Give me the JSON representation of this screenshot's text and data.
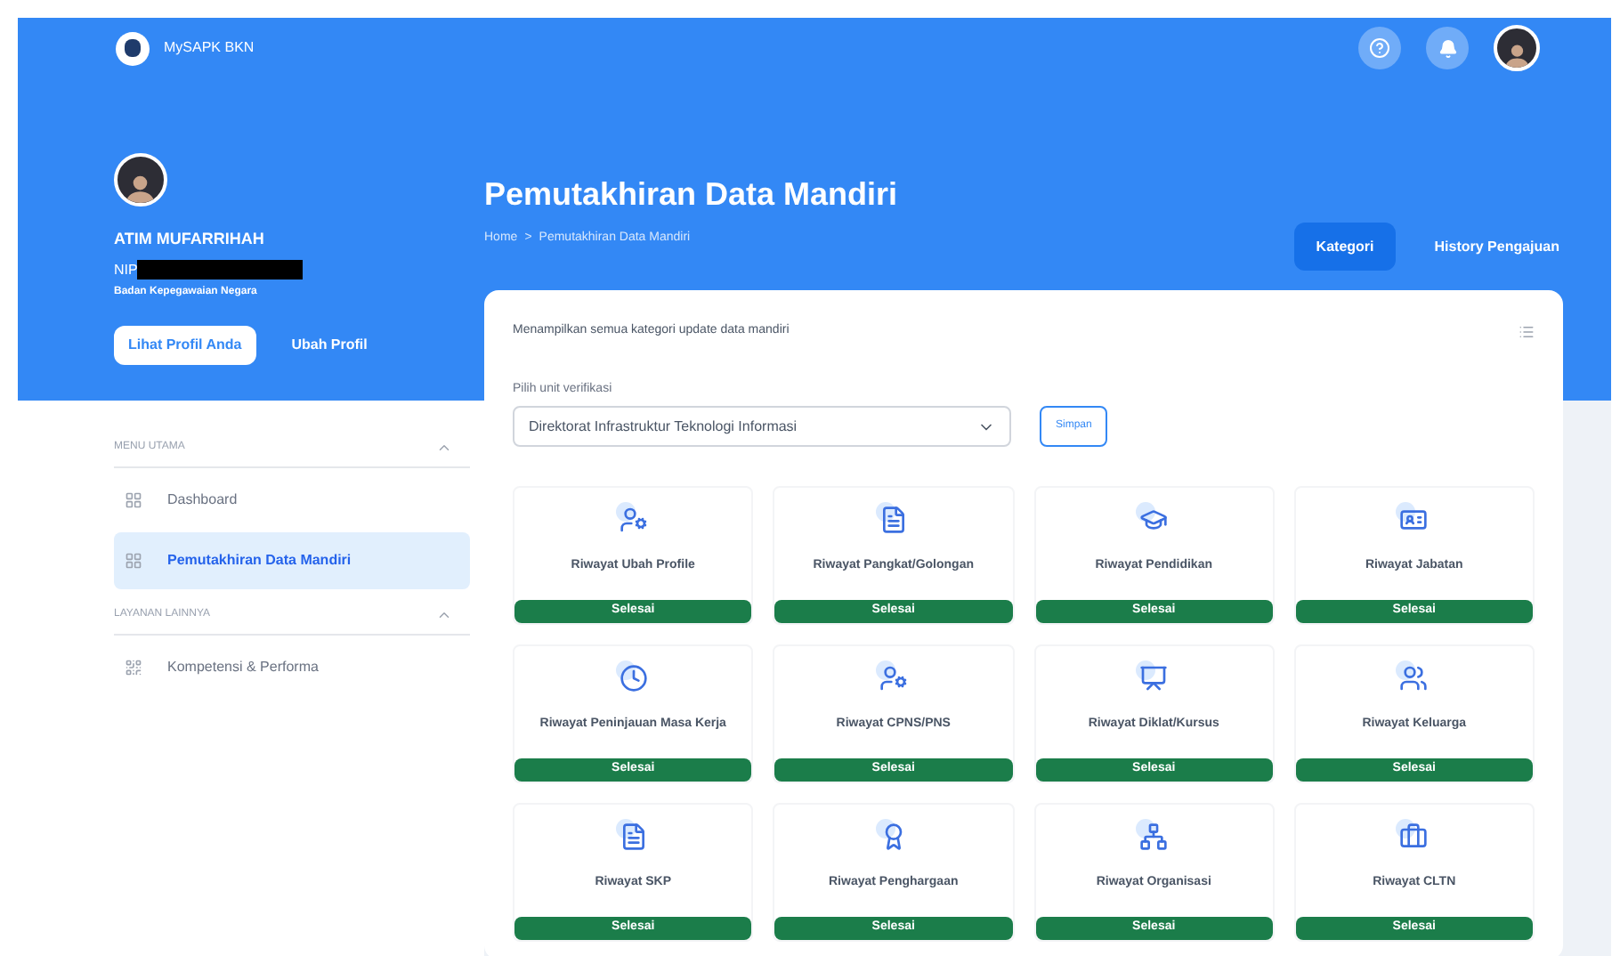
{
  "app": {
    "name": "MySAPK BKN"
  },
  "profile": {
    "name": "ATIM MUFARRIHAH",
    "nip_label": "NIP",
    "agency": "Badan Kepegawaian Negara",
    "buttons": [
      {
        "label": "Lihat Profil Anda",
        "kind": "primary"
      },
      {
        "label": "Ubah Profil",
        "kind": "link"
      }
    ]
  },
  "sidebar": {
    "sections": [
      {
        "title": "MENU UTAMA",
        "expanded": true,
        "items": [
          {
            "label": "Dashboard",
            "selected": false
          },
          {
            "label": "Pemutakhiran Data Mandiri",
            "selected": true
          }
        ]
      },
      {
        "title": "LAYANAN LAINNYA",
        "expanded": true,
        "items": [
          {
            "label": "Kompetensi & Performa",
            "selected": false
          }
        ]
      }
    ]
  },
  "page": {
    "title": "Pemutakhiran Data Mandiri",
    "breadcrumb": [
      "Home",
      ">",
      "Pemutakhiran Data Mandiri"
    ],
    "tabs": [
      {
        "label": "Kategori",
        "selected": true
      },
      {
        "label": "History Pengajuan",
        "selected": false
      }
    ]
  },
  "card": {
    "description": "Menampilkan semua kategori update data mandiri",
    "unit_label": "Pilih unit verifikasi",
    "unit_value": "Direktorat Infrastruktur Teknologi Informasi",
    "save_button": "Simpan",
    "categories": [
      {
        "label": "Riwayat Ubah Profile",
        "status": "Selesai"
      },
      {
        "label": "Riwayat Pangkat/Golongan",
        "status": "Selesai"
      },
      {
        "label": "Riwayat Pendidikan",
        "status": "Selesai"
      },
      {
        "label": "Riwayat Jabatan",
        "status": "Selesai"
      },
      {
        "label": "Riwayat Peninjauan Masa Kerja",
        "status": "Selesai"
      },
      {
        "label": "Riwayat CPNS/PNS",
        "status": "Selesai"
      },
      {
        "label": "Riwayat Diklat/Kursus",
        "status": "Selesai"
      },
      {
        "label": "Riwayat Keluarga",
        "status": "Selesai"
      },
      {
        "label": "Riwayat SKP",
        "status": "Selesai"
      },
      {
        "label": "Riwayat Penghargaan",
        "status": "Selesai"
      },
      {
        "label": "Riwayat Organisasi",
        "status": "Selesai"
      },
      {
        "label": "Riwayat CLTN",
        "status": "Selesai"
      }
    ]
  }
}
